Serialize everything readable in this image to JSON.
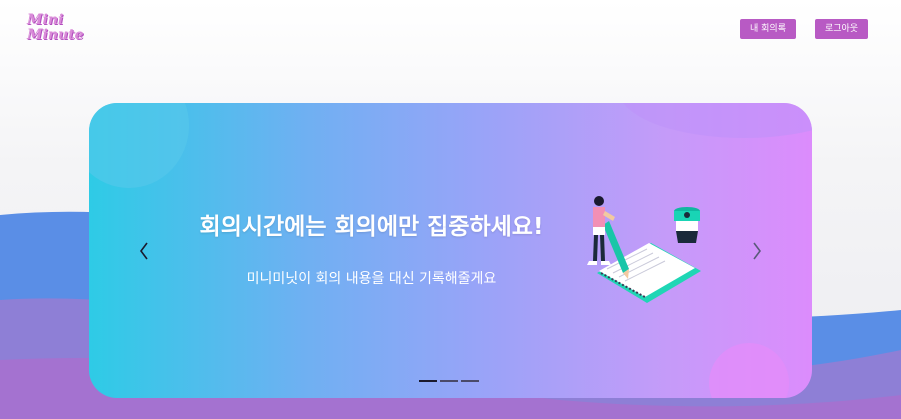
{
  "header": {
    "logo_line1": "Mini",
    "logo_line2": "Minute",
    "my_meetings_label": "내 회의록",
    "logout_label": "로그아웃"
  },
  "carousel": {
    "slide_count": 3,
    "active_index": 0,
    "title": "회의시간에는 회의에만 집중하세요!",
    "subtitle": "미니미닛이 회의 내용을 대신 기록해줄게요",
    "indicator_active_color": "#1a1a2e",
    "indicator_inactive_color": "#4a4a6a",
    "prev_icon": "chevron-left-icon",
    "next_icon": "chevron-right-icon"
  },
  "colors": {
    "accent": "#b85ac4",
    "gradient_start": "#2ecbe6",
    "gradient_end": "#dc8cfc"
  }
}
